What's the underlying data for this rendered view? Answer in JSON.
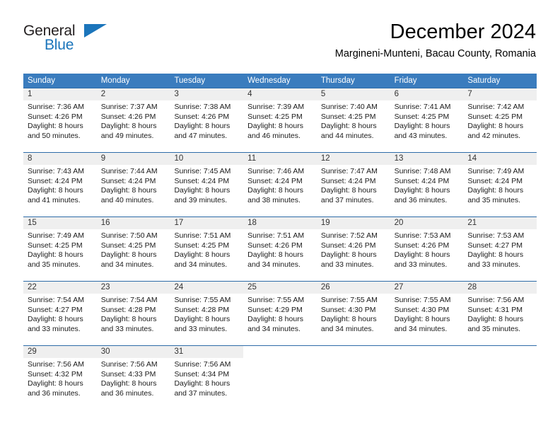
{
  "brand": {
    "line1": "General",
    "line2": "Blue",
    "flag_icon": "triangle-flag-icon",
    "colors": {
      "blue": "#1b75bb",
      "dark": "#231f20"
    }
  },
  "header": {
    "title": "December 2024",
    "subtitle": "Margineni-Munteni, Bacau County, Romania"
  },
  "theme": {
    "header_bg": "#3a7cbe",
    "week_border": "#2e6ca8",
    "daynum_band": "#efefef"
  },
  "calendar": {
    "weekdays": [
      "Sunday",
      "Monday",
      "Tuesday",
      "Wednesday",
      "Thursday",
      "Friday",
      "Saturday"
    ],
    "weeks": [
      [
        {
          "day": "1",
          "sunrise": "Sunrise: 7:36 AM",
          "sunset": "Sunset: 4:26 PM",
          "daylight1": "Daylight: 8 hours",
          "daylight2": "and 50 minutes."
        },
        {
          "day": "2",
          "sunrise": "Sunrise: 7:37 AM",
          "sunset": "Sunset: 4:26 PM",
          "daylight1": "Daylight: 8 hours",
          "daylight2": "and 49 minutes."
        },
        {
          "day": "3",
          "sunrise": "Sunrise: 7:38 AM",
          "sunset": "Sunset: 4:26 PM",
          "daylight1": "Daylight: 8 hours",
          "daylight2": "and 47 minutes."
        },
        {
          "day": "4",
          "sunrise": "Sunrise: 7:39 AM",
          "sunset": "Sunset: 4:25 PM",
          "daylight1": "Daylight: 8 hours",
          "daylight2": "and 46 minutes."
        },
        {
          "day": "5",
          "sunrise": "Sunrise: 7:40 AM",
          "sunset": "Sunset: 4:25 PM",
          "daylight1": "Daylight: 8 hours",
          "daylight2": "and 44 minutes."
        },
        {
          "day": "6",
          "sunrise": "Sunrise: 7:41 AM",
          "sunset": "Sunset: 4:25 PM",
          "daylight1": "Daylight: 8 hours",
          "daylight2": "and 43 minutes."
        },
        {
          "day": "7",
          "sunrise": "Sunrise: 7:42 AM",
          "sunset": "Sunset: 4:25 PM",
          "daylight1": "Daylight: 8 hours",
          "daylight2": "and 42 minutes."
        }
      ],
      [
        {
          "day": "8",
          "sunrise": "Sunrise: 7:43 AM",
          "sunset": "Sunset: 4:24 PM",
          "daylight1": "Daylight: 8 hours",
          "daylight2": "and 41 minutes."
        },
        {
          "day": "9",
          "sunrise": "Sunrise: 7:44 AM",
          "sunset": "Sunset: 4:24 PM",
          "daylight1": "Daylight: 8 hours",
          "daylight2": "and 40 minutes."
        },
        {
          "day": "10",
          "sunrise": "Sunrise: 7:45 AM",
          "sunset": "Sunset: 4:24 PM",
          "daylight1": "Daylight: 8 hours",
          "daylight2": "and 39 minutes."
        },
        {
          "day": "11",
          "sunrise": "Sunrise: 7:46 AM",
          "sunset": "Sunset: 4:24 PM",
          "daylight1": "Daylight: 8 hours",
          "daylight2": "and 38 minutes."
        },
        {
          "day": "12",
          "sunrise": "Sunrise: 7:47 AM",
          "sunset": "Sunset: 4:24 PM",
          "daylight1": "Daylight: 8 hours",
          "daylight2": "and 37 minutes."
        },
        {
          "day": "13",
          "sunrise": "Sunrise: 7:48 AM",
          "sunset": "Sunset: 4:24 PM",
          "daylight1": "Daylight: 8 hours",
          "daylight2": "and 36 minutes."
        },
        {
          "day": "14",
          "sunrise": "Sunrise: 7:49 AM",
          "sunset": "Sunset: 4:24 PM",
          "daylight1": "Daylight: 8 hours",
          "daylight2": "and 35 minutes."
        }
      ],
      [
        {
          "day": "15",
          "sunrise": "Sunrise: 7:49 AM",
          "sunset": "Sunset: 4:25 PM",
          "daylight1": "Daylight: 8 hours",
          "daylight2": "and 35 minutes."
        },
        {
          "day": "16",
          "sunrise": "Sunrise: 7:50 AM",
          "sunset": "Sunset: 4:25 PM",
          "daylight1": "Daylight: 8 hours",
          "daylight2": "and 34 minutes."
        },
        {
          "day": "17",
          "sunrise": "Sunrise: 7:51 AM",
          "sunset": "Sunset: 4:25 PM",
          "daylight1": "Daylight: 8 hours",
          "daylight2": "and 34 minutes."
        },
        {
          "day": "18",
          "sunrise": "Sunrise: 7:51 AM",
          "sunset": "Sunset: 4:26 PM",
          "daylight1": "Daylight: 8 hours",
          "daylight2": "and 34 minutes."
        },
        {
          "day": "19",
          "sunrise": "Sunrise: 7:52 AM",
          "sunset": "Sunset: 4:26 PM",
          "daylight1": "Daylight: 8 hours",
          "daylight2": "and 33 minutes."
        },
        {
          "day": "20",
          "sunrise": "Sunrise: 7:53 AM",
          "sunset": "Sunset: 4:26 PM",
          "daylight1": "Daylight: 8 hours",
          "daylight2": "and 33 minutes."
        },
        {
          "day": "21",
          "sunrise": "Sunrise: 7:53 AM",
          "sunset": "Sunset: 4:27 PM",
          "daylight1": "Daylight: 8 hours",
          "daylight2": "and 33 minutes."
        }
      ],
      [
        {
          "day": "22",
          "sunrise": "Sunrise: 7:54 AM",
          "sunset": "Sunset: 4:27 PM",
          "daylight1": "Daylight: 8 hours",
          "daylight2": "and 33 minutes."
        },
        {
          "day": "23",
          "sunrise": "Sunrise: 7:54 AM",
          "sunset": "Sunset: 4:28 PM",
          "daylight1": "Daylight: 8 hours",
          "daylight2": "and 33 minutes."
        },
        {
          "day": "24",
          "sunrise": "Sunrise: 7:55 AM",
          "sunset": "Sunset: 4:28 PM",
          "daylight1": "Daylight: 8 hours",
          "daylight2": "and 33 minutes."
        },
        {
          "day": "25",
          "sunrise": "Sunrise: 7:55 AM",
          "sunset": "Sunset: 4:29 PM",
          "daylight1": "Daylight: 8 hours",
          "daylight2": "and 34 minutes."
        },
        {
          "day": "26",
          "sunrise": "Sunrise: 7:55 AM",
          "sunset": "Sunset: 4:30 PM",
          "daylight1": "Daylight: 8 hours",
          "daylight2": "and 34 minutes."
        },
        {
          "day": "27",
          "sunrise": "Sunrise: 7:55 AM",
          "sunset": "Sunset: 4:30 PM",
          "daylight1": "Daylight: 8 hours",
          "daylight2": "and 34 minutes."
        },
        {
          "day": "28",
          "sunrise": "Sunrise: 7:56 AM",
          "sunset": "Sunset: 4:31 PM",
          "daylight1": "Daylight: 8 hours",
          "daylight2": "and 35 minutes."
        }
      ],
      [
        {
          "day": "29",
          "sunrise": "Sunrise: 7:56 AM",
          "sunset": "Sunset: 4:32 PM",
          "daylight1": "Daylight: 8 hours",
          "daylight2": "and 36 minutes."
        },
        {
          "day": "30",
          "sunrise": "Sunrise: 7:56 AM",
          "sunset": "Sunset: 4:33 PM",
          "daylight1": "Daylight: 8 hours",
          "daylight2": "and 36 minutes."
        },
        {
          "day": "31",
          "sunrise": "Sunrise: 7:56 AM",
          "sunset": "Sunset: 4:34 PM",
          "daylight1": "Daylight: 8 hours",
          "daylight2": "and 37 minutes."
        },
        {
          "day": "",
          "sunrise": "",
          "sunset": "",
          "daylight1": "",
          "daylight2": ""
        },
        {
          "day": "",
          "sunrise": "",
          "sunset": "",
          "daylight1": "",
          "daylight2": ""
        },
        {
          "day": "",
          "sunrise": "",
          "sunset": "",
          "daylight1": "",
          "daylight2": ""
        },
        {
          "day": "",
          "sunrise": "",
          "sunset": "",
          "daylight1": "",
          "daylight2": ""
        }
      ]
    ]
  }
}
